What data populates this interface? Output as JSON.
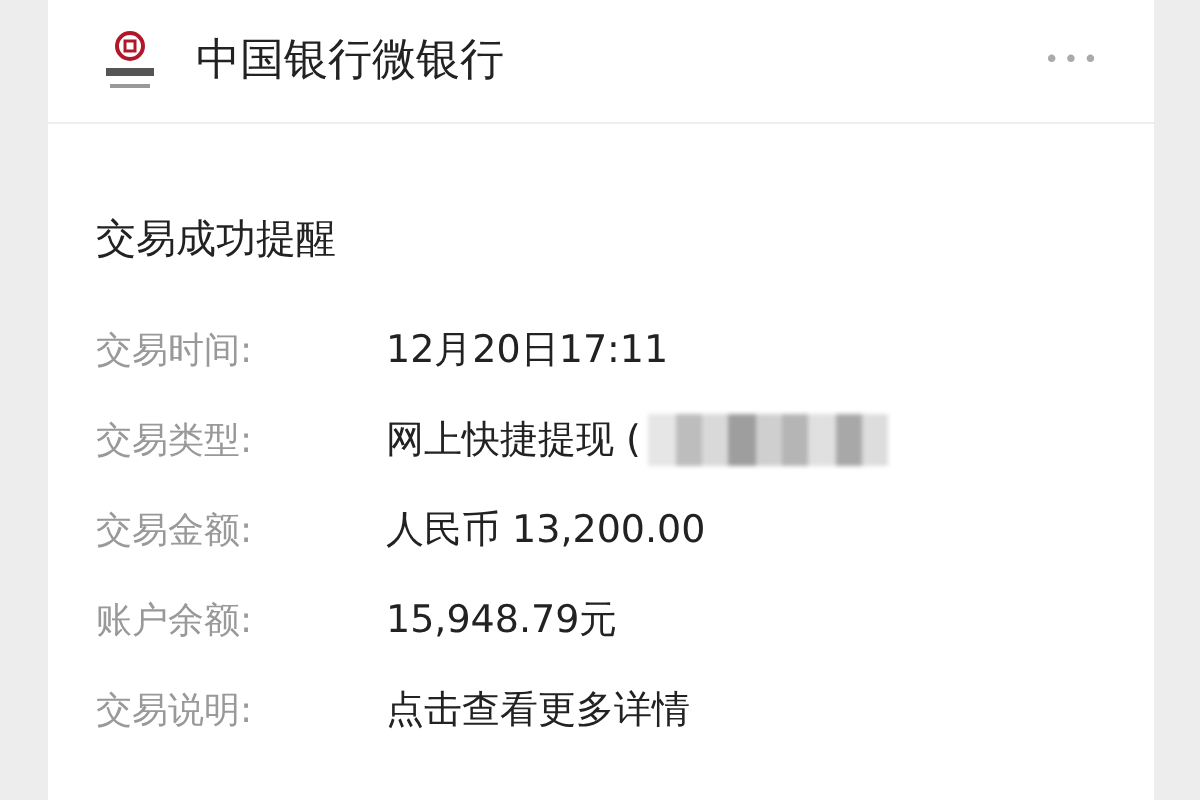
{
  "header": {
    "title": "中国银行微银行",
    "more": "•••"
  },
  "message": {
    "title": "交易成功提醒",
    "rows": [
      {
        "label": "交易时间:",
        "value": "12月20日17:11",
        "redacted": false
      },
      {
        "label": "交易类型:",
        "value": "网上快捷提现 (",
        "redacted": true
      },
      {
        "label": "交易金额:",
        "value": "人民币 13,200.00",
        "redacted": false
      },
      {
        "label": "账户余额:",
        "value": "15,948.79元",
        "redacted": false
      },
      {
        "label": "交易说明:",
        "value": "点击查看更多详情",
        "redacted": false
      }
    ]
  }
}
